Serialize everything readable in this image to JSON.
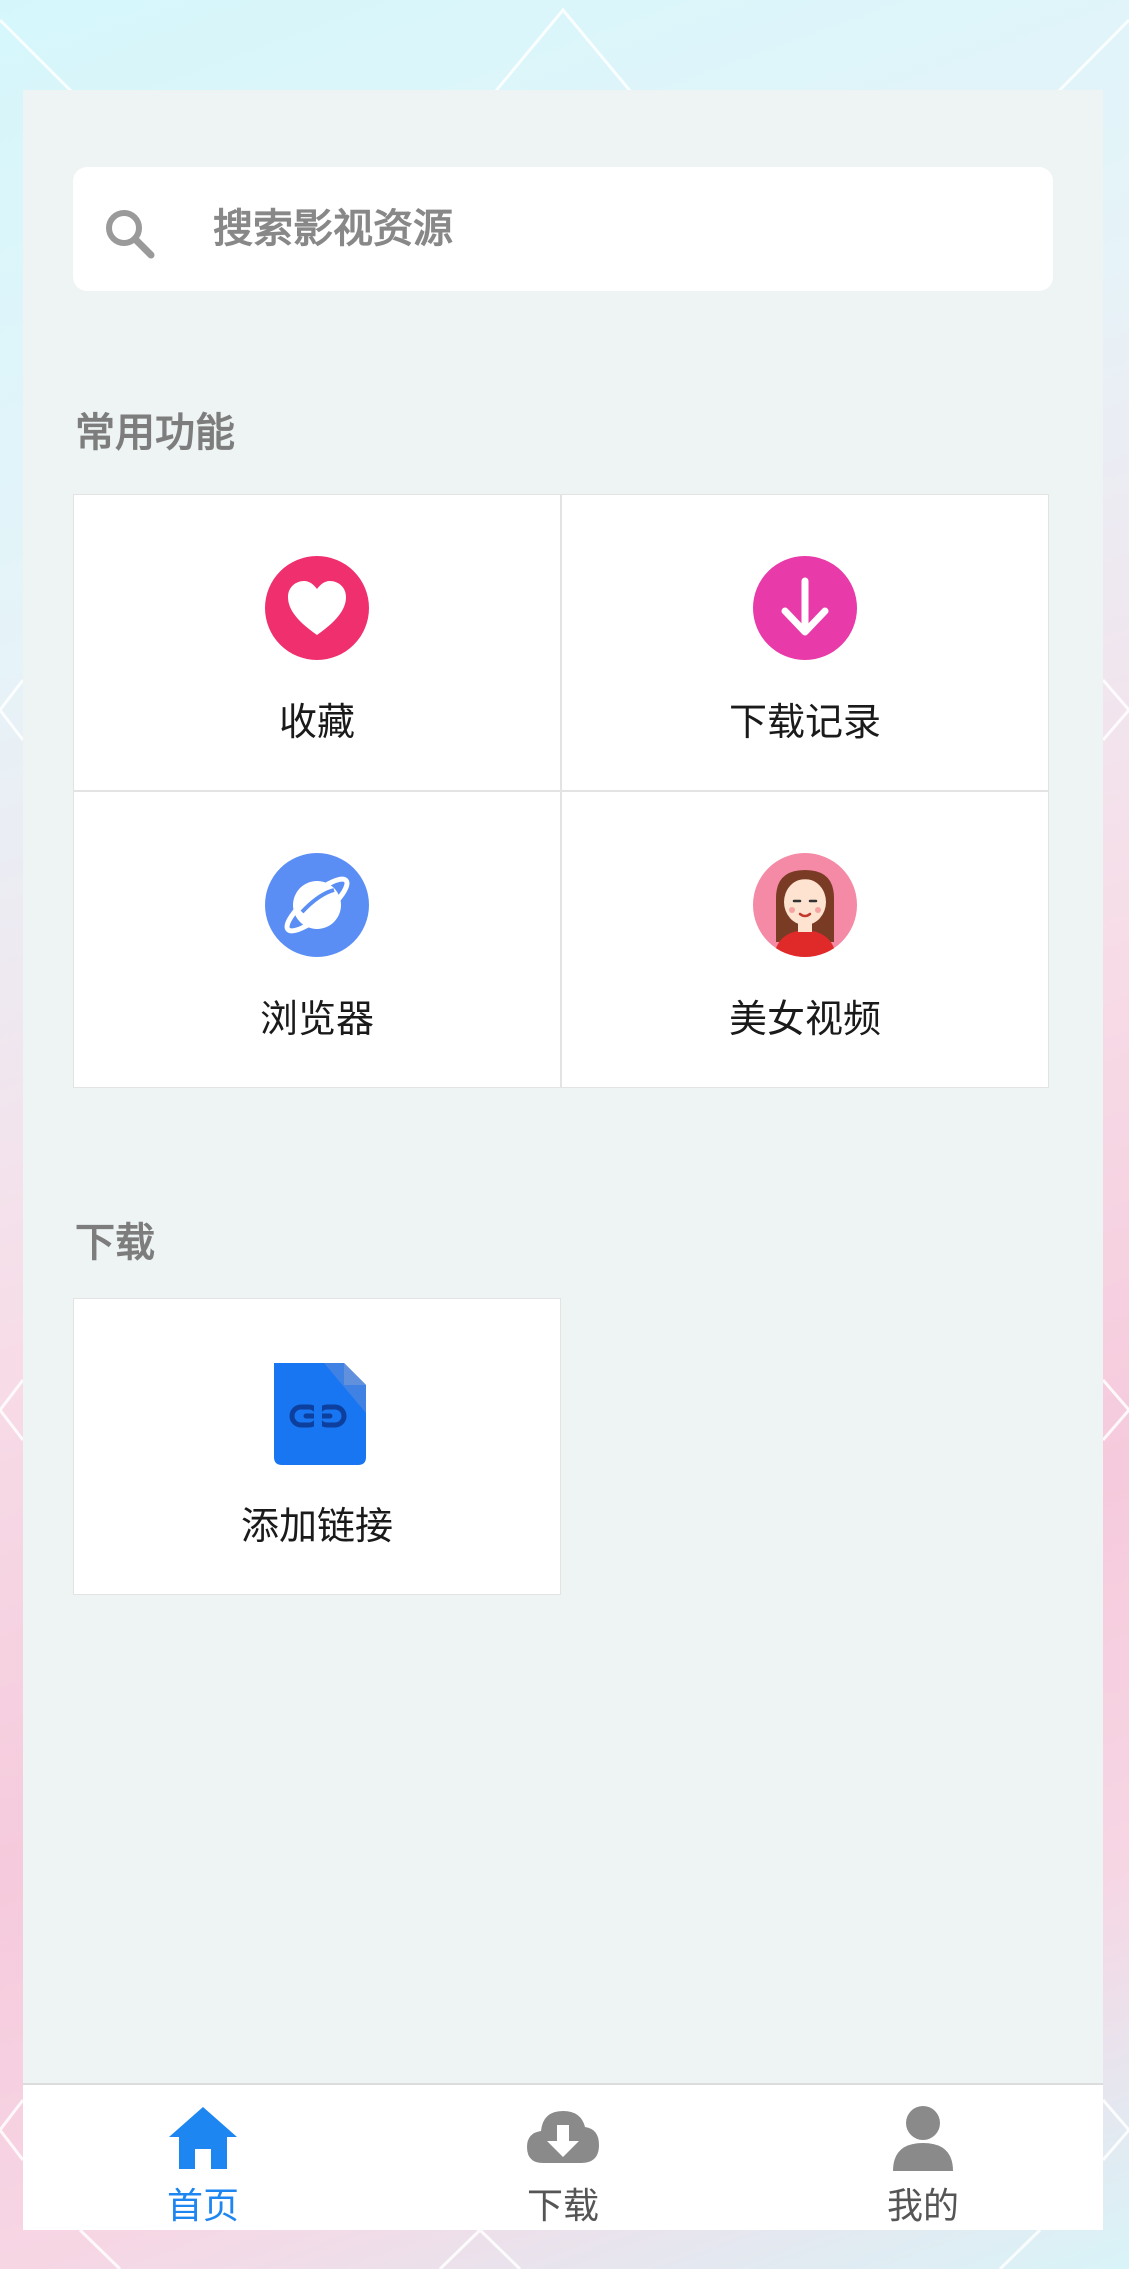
{
  "search": {
    "placeholder": "搜索影视资源"
  },
  "sections": {
    "common_title": "常用功能",
    "download_title": "下载"
  },
  "common_items": [
    {
      "label": "收藏",
      "icon": "heart-icon",
      "color": "#f0306e"
    },
    {
      "label": "下载记录",
      "icon": "download-arrow-icon",
      "color": "#e83aa8"
    },
    {
      "label": "浏览器",
      "icon": "browser-planet-icon",
      "color": "#5b8ef5"
    },
    {
      "label": "美女视频",
      "icon": "girl-avatar-icon",
      "color": "#f58aa6"
    }
  ],
  "download_items": [
    {
      "label": "添加链接",
      "icon": "link-file-icon",
      "color": "#1976f2"
    }
  ],
  "tabbar": {
    "items": [
      {
        "label": "首页",
        "icon": "home-icon",
        "active": true
      },
      {
        "label": "下载",
        "icon": "cloud-download-icon",
        "active": false
      },
      {
        "label": "我的",
        "icon": "user-icon",
        "active": false
      }
    ],
    "active_color": "#1d86f0",
    "inactive_color": "#555555"
  }
}
